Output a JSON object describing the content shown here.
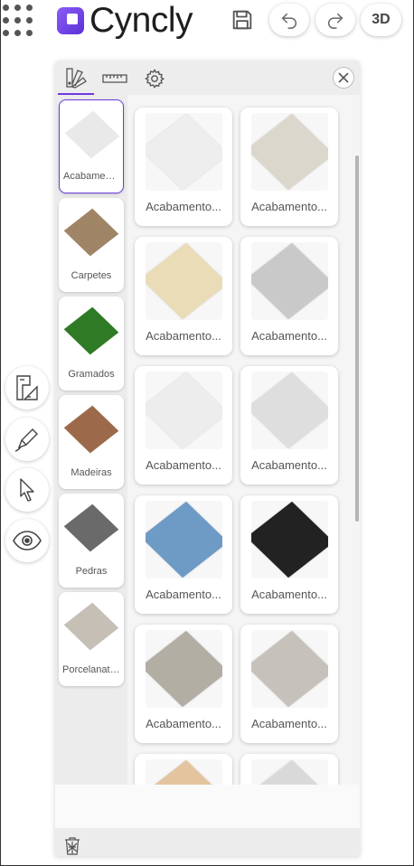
{
  "app": {
    "logo_text": "Cyncly",
    "view_toggle_label": "3D",
    "brand_color": "#6c3be0"
  },
  "toolbar": {
    "menu_icon": "apps-grid-icon",
    "save_icon": "save-icon",
    "undo_icon": "undo-icon",
    "redo_icon": "redo-icon"
  },
  "left_tools": [
    {
      "icon": "floor-plan-icon"
    },
    {
      "icon": "pencil-icon"
    },
    {
      "icon": "pointer-icon"
    },
    {
      "icon": "eye-icon"
    }
  ],
  "panel": {
    "tabs": [
      {
        "icon": "swatches-icon",
        "active": true
      },
      {
        "icon": "ruler-icon",
        "active": false
      },
      {
        "icon": "gear-icon",
        "active": false
      }
    ],
    "close_icon": "close-icon",
    "trash_icon": "trash-icon",
    "categories": [
      {
        "label": "Acabamentos",
        "color": "#e9e9e9",
        "selected": true
      },
      {
        "label": "Carpetes",
        "color": "#a08466"
      },
      {
        "label": "Gramados",
        "color": "#2f7a24"
      },
      {
        "label": "Madeiras",
        "color": "#9c6a4a"
      },
      {
        "label": "Pedras",
        "color": "#6a6a6a"
      },
      {
        "label": "Porcelanatos",
        "color": "#c6bfb6"
      }
    ],
    "products": [
      {
        "label": "Acabamento...",
        "color": "#eeeeee"
      },
      {
        "label": "Acabamento...",
        "color": "#dcd7cd"
      },
      {
        "label": "Acabamento...",
        "color": "#eadcb7"
      },
      {
        "label": "Acabamento...",
        "color": "#c9c9c9"
      },
      {
        "label": "Acabamento...",
        "color": "#ededed"
      },
      {
        "label": "Acabamento...",
        "color": "#dedede"
      },
      {
        "label": "Acabamento...",
        "color": "#6e9bc6"
      },
      {
        "label": "Acabamento...",
        "color": "#222222"
      },
      {
        "label": "Acabamento...",
        "color": "#b3aea4"
      },
      {
        "label": "Acabamento...",
        "color": "#c6c2bb"
      },
      {
        "label": "",
        "color": "#e3c49f"
      },
      {
        "label": "",
        "color": "#d9d9d9"
      }
    ]
  }
}
